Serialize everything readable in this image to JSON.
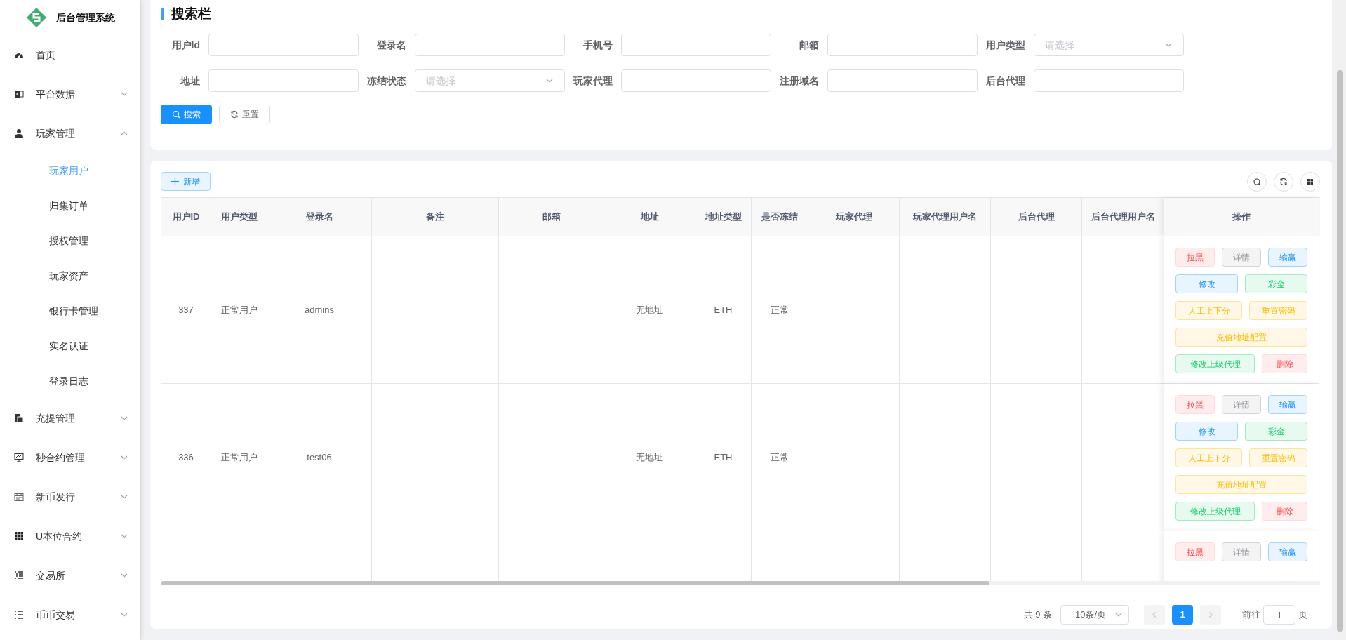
{
  "sidebar": {
    "logo_text": "后台管理系统",
    "items": [
      {
        "label": "首页",
        "kind": "link"
      },
      {
        "label": "平台数据",
        "kind": "group",
        "expanded": false
      },
      {
        "label": "玩家管理",
        "kind": "group",
        "expanded": true,
        "children": [
          {
            "label": "玩家用户",
            "selected": true
          },
          {
            "label": "归集订单",
            "selected": false
          },
          {
            "label": "授权管理",
            "selected": false
          },
          {
            "label": "玩家资产",
            "selected": false
          },
          {
            "label": "银行卡管理",
            "selected": false
          },
          {
            "label": "实名认证",
            "selected": false
          },
          {
            "label": "登录日志",
            "selected": false
          }
        ]
      },
      {
        "label": "充提管理",
        "kind": "group",
        "expanded": false
      },
      {
        "label": "秒合约管理",
        "kind": "group",
        "expanded": false
      },
      {
        "label": "新币发行",
        "kind": "group",
        "expanded": false
      },
      {
        "label": "U本位合约",
        "kind": "group",
        "expanded": false
      },
      {
        "label": "交易所",
        "kind": "group",
        "expanded": false
      },
      {
        "label": "币币交易",
        "kind": "group",
        "expanded": false
      }
    ]
  },
  "search_panel": {
    "title": "搜索栏",
    "fields": [
      {
        "label": "用户Id",
        "kind": "input"
      },
      {
        "label": "登录名",
        "kind": "input"
      },
      {
        "label": "手机号",
        "kind": "input"
      },
      {
        "label": "邮箱",
        "kind": "input"
      },
      {
        "label": "用户类型",
        "kind": "select",
        "placeholder": "请选择"
      },
      {
        "label": "地址",
        "kind": "input"
      },
      {
        "label": "冻结状态",
        "kind": "select",
        "placeholder": "请选择"
      },
      {
        "label": "玩家代理",
        "kind": "input"
      },
      {
        "label": "注册域名",
        "kind": "input"
      },
      {
        "label": "后台代理",
        "kind": "input"
      }
    ],
    "buttons": [
      {
        "label": "搜索",
        "kind": "primary"
      },
      {
        "label": "重置",
        "kind": "default"
      }
    ]
  },
  "table_panel": {
    "add_button": "新增",
    "columns": [
      "用户ID",
      "用户类型",
      "登录名",
      "备注",
      "邮箱",
      "地址",
      "地址类型",
      "是否冻结",
      "玩家代理",
      "玩家代理用户名",
      "后台代理",
      "后台代理用户名",
      "操作"
    ],
    "rows": [
      {
        "user_id": "337",
        "user_type": "正常用户",
        "login_name": "admins",
        "address": "无地址",
        "address_type": "ETH",
        "frozen": "正常",
        "action_rows": [
          [
            {
              "label": "拉黑",
              "kind": "danger"
            },
            {
              "label": "详情",
              "kind": "info"
            },
            {
              "label": "输赢",
              "kind": "primary"
            }
          ],
          [
            {
              "label": "修改",
              "kind": "primary"
            },
            {
              "label": "彩金",
              "kind": "success"
            }
          ],
          [
            {
              "label": "人工上下分",
              "kind": "warning"
            },
            {
              "label": "重置密码",
              "kind": "warning"
            }
          ],
          [
            {
              "label": "充值地址配置",
              "kind": "warning"
            }
          ],
          [
            {
              "label": "修改上级代理",
              "kind": "success"
            },
            {
              "label": "删除",
              "kind": "danger"
            }
          ]
        ]
      },
      {
        "user_id": "336",
        "user_type": "正常用户",
        "login_name": "test06",
        "address": "无地址",
        "address_type": "ETH",
        "frozen": "正常",
        "action_rows": [
          [
            {
              "label": "拉黑",
              "kind": "danger"
            },
            {
              "label": "详情",
              "kind": "info"
            },
            {
              "label": "输赢",
              "kind": "primary"
            }
          ],
          [
            {
              "label": "修改",
              "kind": "primary"
            },
            {
              "label": "彩金",
              "kind": "success"
            }
          ],
          [
            {
              "label": "人工上下分",
              "kind": "warning"
            },
            {
              "label": "重置密码",
              "kind": "warning"
            }
          ],
          [
            {
              "label": "充值地址配置",
              "kind": "warning"
            }
          ],
          [
            {
              "label": "修改上级代理",
              "kind": "success"
            },
            {
              "label": "删除",
              "kind": "danger"
            }
          ]
        ]
      },
      {
        "action_rows": [
          [
            {
              "label": "拉黑",
              "kind": "danger"
            },
            {
              "label": "详情",
              "kind": "info"
            },
            {
              "label": "输赢",
              "kind": "primary"
            }
          ]
        ]
      }
    ],
    "pagination": {
      "total": "共 9 条",
      "page_size": "10条/页",
      "pages": [
        {
          "label": "1",
          "selected": true
        }
      ],
      "goto_label": "前往",
      "goto_value": "1",
      "page_suffix": "页"
    }
  }
}
